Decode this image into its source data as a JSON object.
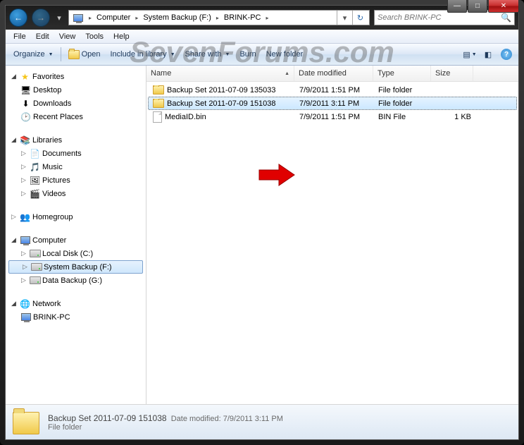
{
  "window": {
    "title_buttons": {
      "min": "—",
      "max": "□",
      "close": "✕"
    }
  },
  "nav": {
    "back_glyph": "←",
    "fwd_glyph": "→"
  },
  "address": {
    "crumbs": [
      "Computer",
      "System Backup (F:)",
      "BRINK-PC"
    ],
    "arrow": "▸"
  },
  "search": {
    "placeholder": "Search BRINK-PC",
    "icon": "🔍"
  },
  "menubar": [
    "File",
    "Edit",
    "View",
    "Tools",
    "Help"
  ],
  "cmdbar": {
    "organize": "Organize",
    "open": "Open",
    "include": "Include in library",
    "share": "Share with",
    "burn": "Burn",
    "newfolder": "New folder"
  },
  "tree": {
    "favorites": {
      "label": "Favorites",
      "items": [
        "Desktop",
        "Downloads",
        "Recent Places"
      ]
    },
    "libraries": {
      "label": "Libraries",
      "items": [
        "Documents",
        "Music",
        "Pictures",
        "Videos"
      ]
    },
    "homegroup": {
      "label": "Homegroup"
    },
    "computer": {
      "label": "Computer",
      "items": [
        "Local Disk (C:)",
        "System Backup (F:)",
        "Data Backup (G:)"
      ]
    },
    "network": {
      "label": "Network",
      "items": [
        "BRINK-PC"
      ]
    }
  },
  "columns": {
    "name": "Name",
    "date": "Date modified",
    "type": "Type",
    "size": "Size"
  },
  "files": [
    {
      "name": "Backup Set 2011-07-09 135033",
      "date": "7/9/2011 1:51 PM",
      "type": "File folder",
      "size": "",
      "icon": "folder",
      "selected": false
    },
    {
      "name": "Backup Set 2011-07-09 151038",
      "date": "7/9/2011 3:11 PM",
      "type": "File folder",
      "size": "",
      "icon": "folder",
      "selected": true
    },
    {
      "name": "MediaID.bin",
      "date": "7/9/2011 1:51 PM",
      "type": "BIN File",
      "size": "1 KB",
      "icon": "file",
      "selected": false
    }
  ],
  "details": {
    "name": "Backup Set 2011-07-09 151038",
    "meta_label": "Date modified:",
    "meta_value": "7/9/2011 3:11 PM",
    "sub": "File folder"
  },
  "watermark": "SevenForums.com"
}
